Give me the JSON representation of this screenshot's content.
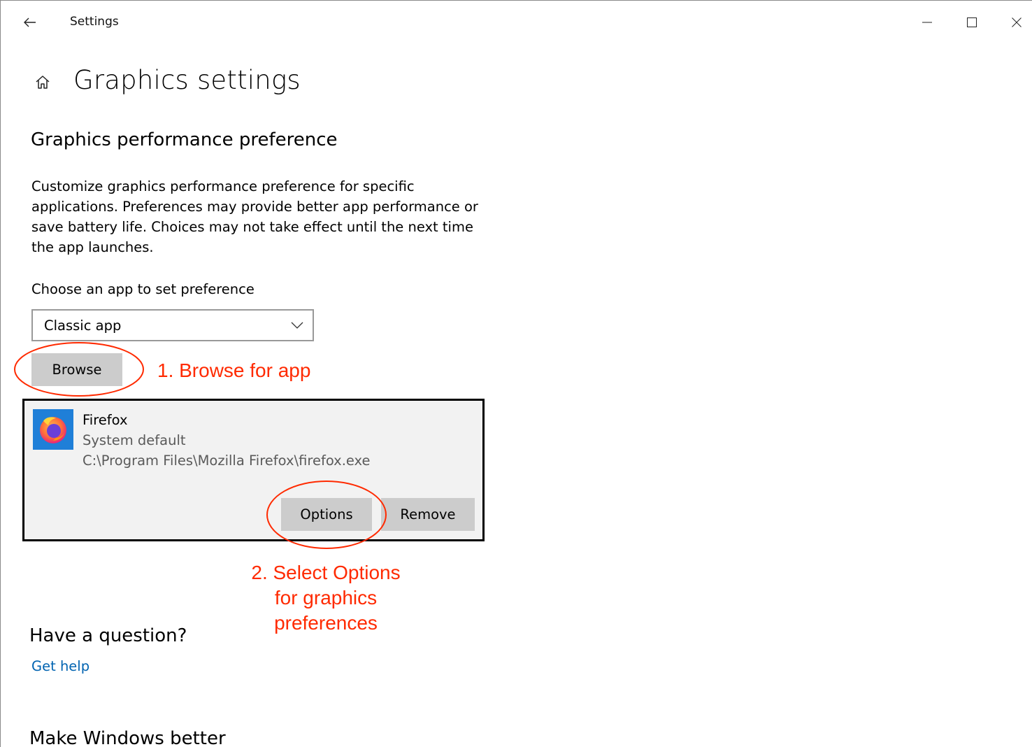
{
  "window": {
    "title": "Settings",
    "back_icon": "arrow-left-icon",
    "controls": {
      "minimize_icon": "minimize-icon",
      "maximize_icon": "maximize-icon",
      "close_icon": "close-icon"
    }
  },
  "page": {
    "home_icon": "home-icon",
    "title": "Graphics settings"
  },
  "preference": {
    "heading": "Graphics performance preference",
    "description": "Customize graphics performance preference for specific applications. Preferences may provide better app performance or save battery life. Choices may not take effect until the next time the app launches.",
    "choose_label": "Choose an app to set preference",
    "selected_app_type": "Classic app",
    "browse_label": "Browse"
  },
  "app_entry": {
    "name": "Firefox",
    "preference": "System default",
    "path": "C:\\Program Files\\Mozilla Firefox\\firefox.exe",
    "options_label": "Options",
    "remove_label": "Remove"
  },
  "annotations": {
    "step1": "1. Browse for app",
    "step2_lines": [
      "2. Select Options",
      "for graphics",
      "preferences"
    ],
    "color": "#ff2a00"
  },
  "help": {
    "heading": "Have a question?",
    "link": "Get help"
  },
  "feedback": {
    "heading": "Make Windows better"
  },
  "colors": {
    "link": "#0063b1",
    "button_bg": "#cccccc",
    "card_bg": "#f2f2f2"
  }
}
